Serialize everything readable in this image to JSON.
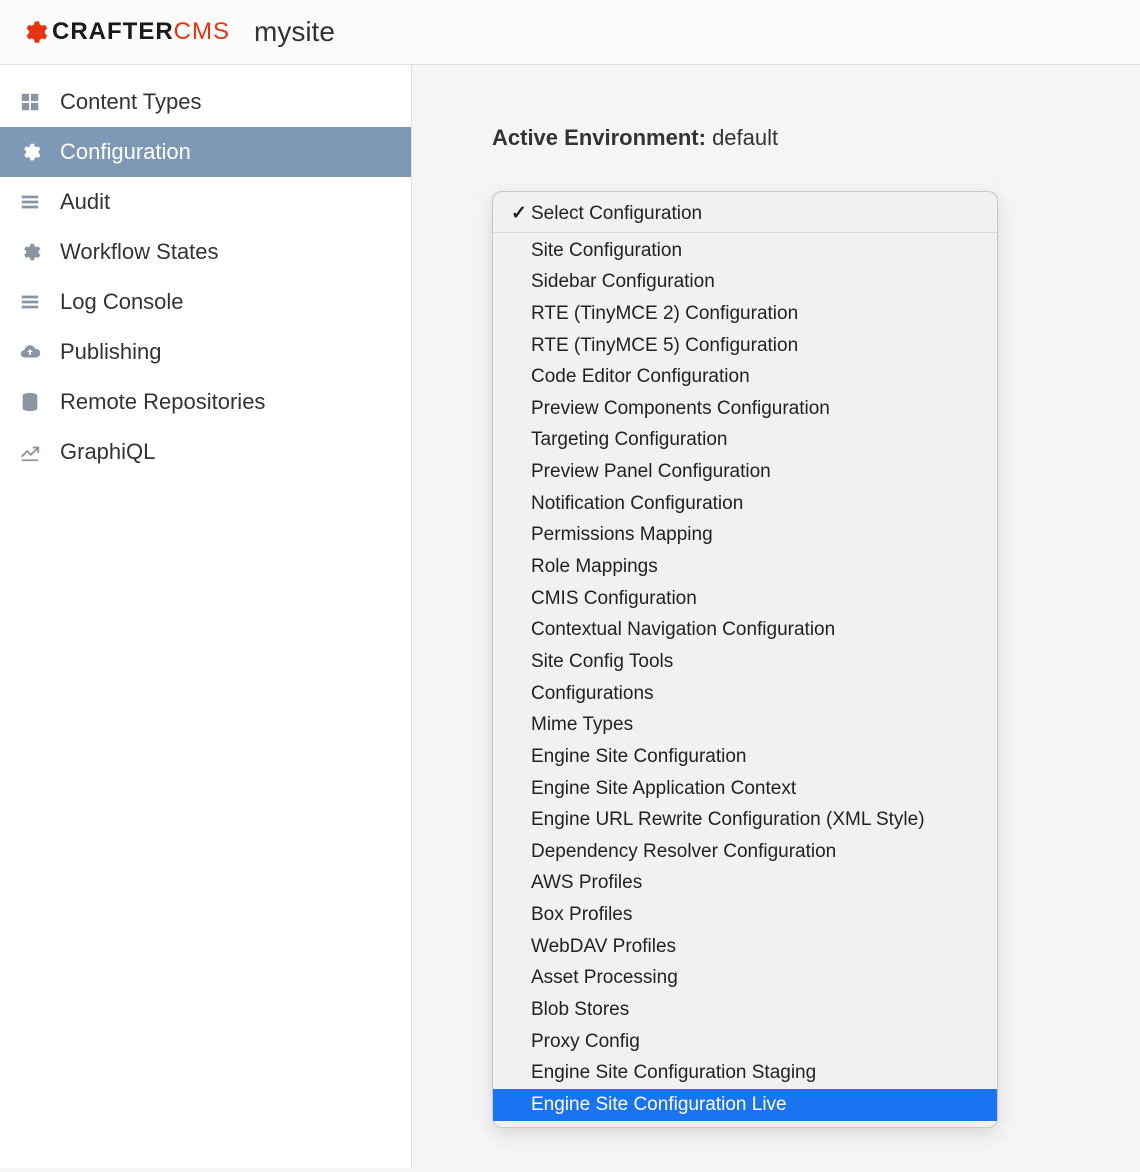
{
  "header": {
    "logo_black": "CRAFTER",
    "logo_red": "CMS",
    "site_name": "mysite"
  },
  "sidebar": {
    "items": [
      {
        "label": "Content Types",
        "icon": "grid-icon"
      },
      {
        "label": "Configuration",
        "icon": "gear-icon"
      },
      {
        "label": "Audit",
        "icon": "list-icon"
      },
      {
        "label": "Workflow States",
        "icon": "gear-icon"
      },
      {
        "label": "Log Console",
        "icon": "list-icon"
      },
      {
        "label": "Publishing",
        "icon": "cloud-up-icon"
      },
      {
        "label": "Remote Repositories",
        "icon": "database-icon"
      },
      {
        "label": "GraphiQL",
        "icon": "chart-icon"
      }
    ],
    "active_index": 1
  },
  "main": {
    "env_label": "Active Environment:",
    "env_value": "default"
  },
  "dropdown": {
    "selected_index": 0,
    "highlight_index": 28,
    "separator_after_index": 0,
    "options": [
      "Select Configuration",
      "Site Configuration",
      "Sidebar Configuration",
      "RTE (TinyMCE 2) Configuration",
      "RTE (TinyMCE 5) Configuration",
      "Code Editor Configuration",
      "Preview Components Configuration",
      "Targeting Configuration",
      "Preview Panel Configuration",
      "Notification Configuration",
      "Permissions Mapping",
      "Role Mappings",
      "CMIS Configuration",
      "Contextual Navigation Configuration",
      "Site Config Tools",
      "Configurations",
      "Mime Types",
      "Engine Site Configuration",
      "Engine Site Application Context",
      "Engine URL Rewrite Configuration (XML Style)",
      "Dependency Resolver Configuration",
      "AWS Profiles",
      "Box Profiles",
      "WebDAV Profiles",
      "Asset Processing",
      "Blob Stores",
      "Proxy Config",
      "Engine Site Configuration Staging",
      "Engine Site Configuration Live"
    ]
  }
}
